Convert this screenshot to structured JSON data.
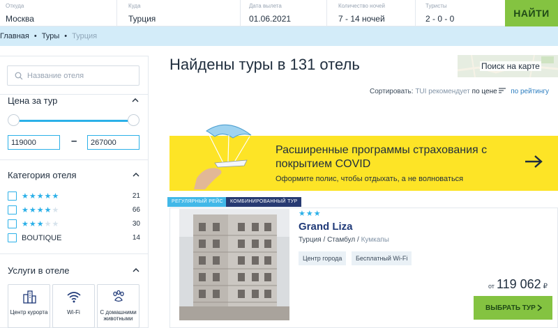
{
  "search": {
    "from_label": "Откуда",
    "from_value": "Москва",
    "to_label": "Куда",
    "to_value": "Турция",
    "date_label": "Дата вылета",
    "date_value": "01.06.2021",
    "nights_label": "Количество ночей",
    "nights_value": "7 - 14 ночей",
    "tourists_label": "Туристы",
    "tourists_value": "2 - 0 - 0",
    "find_label": "НАЙТИ"
  },
  "breadcrumb": [
    "Главная",
    "Туры",
    "Турция"
  ],
  "sidebar": {
    "hotel_search_placeholder": "Название отеля",
    "price_title": "Цена за тур",
    "price_min": "119000",
    "price_max": "267000",
    "price_dash": "–",
    "category_title": "Категория отеля",
    "categories": [
      {
        "stars": 5,
        "count": "21"
      },
      {
        "stars": 4,
        "count": "66"
      },
      {
        "stars": 3,
        "count": "30"
      },
      {
        "label": "BOUTIQUE",
        "count": "14"
      }
    ],
    "services_title": "Услуги в отеле",
    "services": [
      {
        "label": "Центр курорта",
        "icon": "city-center-icon"
      },
      {
        "label": "Wi-Fi",
        "icon": "wifi-icon"
      },
      {
        "label": "С домашними животными",
        "icon": "paw-icon"
      }
    ]
  },
  "main": {
    "heading": "Найдены туры в 131 отель",
    "map_button": "Поиск на карте",
    "sort_label": "Сортировать:",
    "sort_recommend": "TUI рекомендует",
    "sort_price": "по цене",
    "sort_rating": "по рейтингу"
  },
  "banner": {
    "title": "Расширенные программы страхования с покрытием COVID",
    "subtitle": "Оформите полис, чтобы отдыхать, а не волноваться",
    "color": "#fde426"
  },
  "hotel": {
    "tag_flight": "РЕГУЛЯРНЫЙ РЕЙС",
    "tag_tour": "КОМБИНИРОВАННЫЙ ТУР",
    "stars": 3,
    "name": "Grand Liza",
    "country": "Турция",
    "city": "Стамбул",
    "district": "Кумкапы",
    "sep": "/",
    "features": [
      "Центр города",
      "Бесплатный Wi-Fi"
    ],
    "price_from": "от",
    "price": "119 062",
    "currency": "₽",
    "select_label": "ВЫБРАТЬ ТУР"
  },
  "colors": {
    "accent_green": "#84c341",
    "accent_blue": "#2bb0e8",
    "breadcrumb_bg": "#d3ecf9",
    "hotel_name": "#203a78"
  }
}
